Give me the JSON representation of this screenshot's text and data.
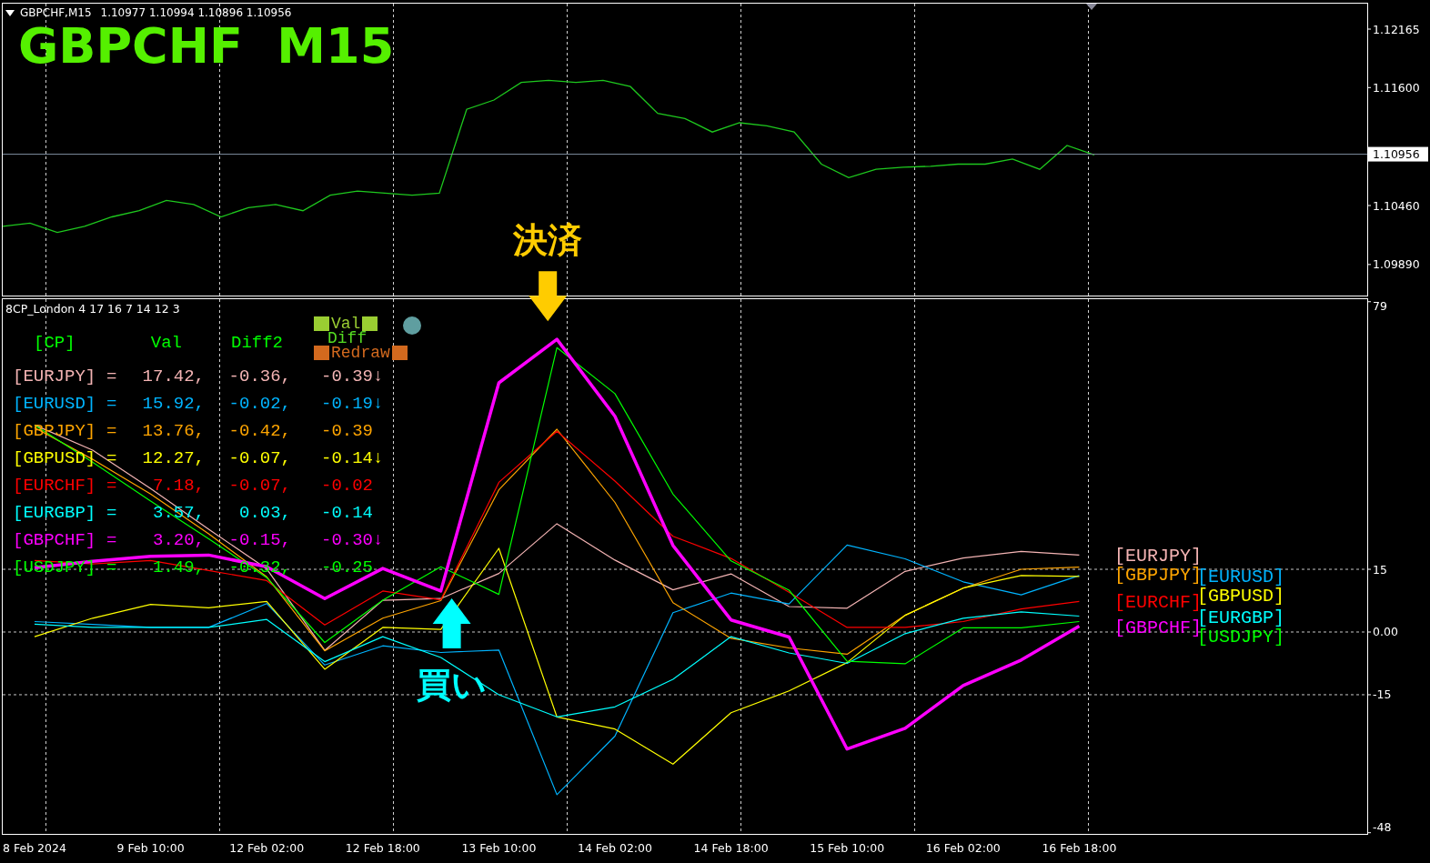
{
  "price_pane": {
    "symbol": "GBPCHF,M15",
    "ohlc": "1.10977 1.10994 1.10896 1.10956",
    "title": "GBPCHF  M15",
    "current_price": "1.10956",
    "chart_data": {
      "type": "line",
      "categories": [
        null,
        null,
        null,
        null,
        null,
        null,
        null,
        null,
        null,
        null,
        null,
        null,
        null,
        null,
        null,
        null,
        null,
        null,
        null,
        null,
        null,
        null,
        null,
        null,
        null,
        null,
        null,
        null,
        null,
        null,
        null,
        null,
        null,
        null,
        null,
        null,
        null,
        null,
        null,
        null,
        null,
        null,
        null,
        null,
        null,
        null,
        null,
        null,
        null,
        null,
        null
      ],
      "ylim": [
        1.0959,
        1.1242
      ],
      "yticks": [
        {
          "value": 1.12165,
          "label": "1.12165"
        },
        {
          "value": 1.116,
          "label": "1.11600"
        },
        {
          "value": 1.1046,
          "label": "1.10460"
        },
        {
          "value": 1.0989,
          "label": "1.09890"
        }
      ],
      "series": [
        {
          "color": "#1ec81e",
          "values": [
            1.1026,
            1.1029,
            1.102,
            1.1026,
            1.1035,
            1.1041,
            1.1051,
            1.1047,
            1.1035,
            1.1044,
            1.1047,
            1.1041,
            1.1056,
            1.106,
            1.1058,
            1.1056,
            1.1058,
            1.1139,
            1.1148,
            1.1165,
            1.1167,
            1.1165,
            1.1167,
            1.1161,
            1.1135,
            1.113,
            1.1117,
            1.1126,
            1.1123,
            1.1117,
            1.1086,
            1.1073,
            1.1081,
            1.1083,
            1.1084,
            1.1086,
            1.1086,
            1.1091,
            1.1081,
            1.1104,
            1.1095,
            null,
            null,
            null,
            null,
            null,
            null,
            null,
            null,
            null,
            null
          ]
        },
        {
          "color": "#7f8fa0",
          "values": [
            1.10956,
            1.10956,
            1.10956,
            1.10956,
            1.10956,
            1.10956,
            1.10956,
            1.10956,
            1.10956,
            1.10956,
            1.10956,
            1.10956,
            1.10956,
            1.10956,
            1.10956,
            1.10956,
            1.10956,
            1.10956,
            1.10956,
            1.10956,
            1.10956,
            1.10956,
            1.10956,
            1.10956,
            1.10956,
            1.10956,
            1.10956,
            1.10956,
            1.10956,
            1.10956,
            1.10956,
            1.10956,
            1.10956,
            1.10956,
            1.10956,
            1.10956,
            1.10956,
            1.10956,
            1.10956,
            1.10956,
            1.10956,
            1.10956,
            1.10956,
            1.10956,
            1.10956,
            1.10956,
            1.10956,
            1.10956,
            1.10956,
            1.10956,
            1.10956
          ]
        }
      ]
    }
  },
  "indicator_pane": {
    "title": "8CP_London 4 17 16 7 14 12 3",
    "legend": {
      "columns": [
        "[CP]",
        "Val",
        "Diff2"
      ],
      "rows": [
        {
          "pair": "[EURJPY]",
          "equals": "=",
          "val": "17.42,",
          "diff2": "-0.36,",
          "diff": "-0.39",
          "trend": "↓",
          "color": "#f4b4b4"
        },
        {
          "pair": "[EURUSD]",
          "equals": "=",
          "val": "15.92,",
          "diff2": "-0.02,",
          "diff": "-0.19",
          "trend": "↓",
          "color": "#00b4ff"
        },
        {
          "pair": "[GBPJPY]",
          "equals": "=",
          "val": "13.76,",
          "diff2": "-0.42,",
          "diff": "-0.39",
          "color": "#ffa500"
        },
        {
          "pair": "[GBPUSD]",
          "equals": "=",
          "val": "12.27,",
          "diff2": "-0.07,",
          "diff": "-0.14",
          "trend": "↓",
          "color": "#ffff00"
        },
        {
          "pair": "[EURCHF]",
          "equals": "=",
          "val": "7.18,",
          "diff2": "-0.07,",
          "diff": "-0.02",
          "color": "#ff0000"
        },
        {
          "pair": "[EURGBP]",
          "equals": "=",
          "val": "3.57,",
          "diff2": "0.03,",
          "diff": "-0.14",
          "color": "#00ffff"
        },
        {
          "pair": "[GBPCHF]",
          "equals": "=",
          "val": "3.20,",
          "diff2": "-0.15,",
          "diff": "-0.30",
          "trend": "↓",
          "color": "#ff00ff",
          "signals": [
            {
              "text": "決済",
              "kind": "exit",
              "color": "#ffcc00"
            },
            {
              "text": "買い",
              "kind": "entry",
              "color": "#00ffff"
            }
          ]
        },
        {
          "pair": "[USDJPY]",
          "equals": "=",
          "val": "1.49,",
          "diff2": "-0.32,",
          "diff": "-0.25",
          "color": "#00ff00"
        }
      ]
    },
    "buttons": [
      {
        "label": "Val",
        "kind": "boxed",
        "color": "#9acd32"
      },
      {
        "label": "Diff",
        "kind": "plain",
        "color": "#55dd22"
      },
      {
        "label": "Redraw",
        "kind": "boxed",
        "color": "#d2691e"
      }
    ],
    "chart_data": {
      "type": "line",
      "grid": true,
      "categories": [
        "8 Feb 2024",
        null,
        "9 Feb 10:00",
        null,
        "12 Feb 02:00",
        null,
        "12 Feb 18:00",
        null,
        "13 Feb 10:00",
        null,
        "14 Feb 02:00",
        null,
        "14 Feb 18:00",
        null,
        "15 Feb 10:00",
        null,
        "16 Feb 02:00",
        null,
        "16 Feb 18:00"
      ],
      "ylim": [
        -48.5,
        79.6
      ],
      "yticks": [
        79,
        15,
        {
          "value": 0,
          "label": "0.00"
        },
        -15,
        -48
      ],
      "series": [
        {
          "name": "[EURJPY]",
          "color": "#f4b4b4",
          "values": [
            49.5,
            43.5,
            34.3,
            24.6,
            15.1,
            -4.4,
            7.6,
            8.0,
            14.0,
            25.9,
            17.2,
            10.1,
            13.9,
            6.1,
            5.7,
            14.5,
            17.7,
            19.3,
            18.4
          ]
        },
        {
          "name": "[EURUSD]",
          "color": "#00b4ff",
          "values": [
            2.5,
            1.8,
            1.1,
            1.1,
            6.8,
            -7.9,
            -3.3,
            -4.9,
            -4.3,
            -38.9,
            -24.9,
            4.6,
            9.3,
            6.7,
            20.8,
            17.5,
            12.0,
            8.9,
            13.5
          ]
        },
        {
          "name": "[GBPJPY]",
          "color": "#ffa500",
          "values": [
            48.9,
            41.3,
            33.0,
            23.5,
            13.2,
            -4.5,
            3.3,
            7.5,
            34.0,
            48.5,
            31.0,
            7.0,
            -1.5,
            -3.8,
            -5.3,
            4.0,
            10.5,
            15.0,
            15.5
          ]
        },
        {
          "name": "[GBPUSD]",
          "color": "#ffff00",
          "values": [
            -1.1,
            3.3,
            6.6,
            5.8,
            7.3,
            -8.9,
            1.1,
            0.6,
            20.0,
            -20.3,
            -23.2,
            -31.6,
            -19.3,
            -14.1,
            -7.3,
            4.0,
            10.5,
            13.5,
            13.3
          ]
        },
        {
          "name": "[EURCHF]",
          "color": "#ff0000",
          "values": [
            17.1,
            16.3,
            17.1,
            14.7,
            12.3,
            1.7,
            9.8,
            7.7,
            35.8,
            48.0,
            36.1,
            22.9,
            17.6,
            9.5,
            1.1,
            1.1,
            2.5,
            5.5,
            7.3
          ]
        },
        {
          "name": "[EURGBP]",
          "color": "#00ffff",
          "values": [
            1.9,
            1.1,
            1.1,
            1.1,
            3.0,
            -7.1,
            -1.1,
            -6.1,
            -15.0,
            -20.3,
            -17.9,
            -11.3,
            -1.1,
            -5.0,
            -7.5,
            -0.4,
            3.3,
            4.8,
            3.8
          ]
        },
        {
          "name": "[GBPCHF]",
          "color": "#ff00ff",
          "values": [
            15.4,
            16.9,
            18.1,
            18.4,
            15.6,
            8.0,
            15.2,
            9.8,
            59.6,
            70.0,
            51.6,
            20.7,
            2.9,
            -1.2,
            -28.0,
            -23.0,
            -12.8,
            -6.7,
            1.4
          ]
        },
        {
          "name": "[USDJPY]",
          "color": "#00ff00",
          "values": [
            49.5,
            40.6,
            31.3,
            22.3,
            13.0,
            -2.5,
            7.6,
            15.6,
            9.0,
            68.0,
            57.0,
            33.0,
            17.0,
            10.0,
            -7.0,
            -7.6,
            1.0,
            1.0,
            2.5
          ]
        }
      ]
    }
  }
}
